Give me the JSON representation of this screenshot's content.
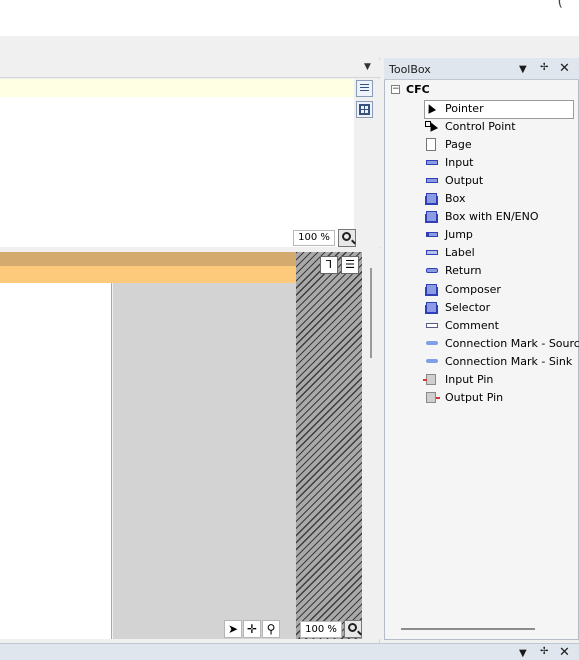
{
  "top_right_glyph": "(",
  "declaration_pane": {
    "dropdown_icon": "chevron-down-icon",
    "zoom": "100 %"
  },
  "cfc_editor": {
    "zoom": "100 %",
    "tools": [
      "pointer-tool",
      "move-tool",
      "zoom-tool"
    ]
  },
  "toolbox": {
    "title": "ToolBox",
    "root": "CFC",
    "toggle": "−",
    "items": [
      {
        "label": "Pointer",
        "icon": "pointer-icon"
      },
      {
        "label": "Control Point",
        "icon": "control-point-icon"
      },
      {
        "label": "Page",
        "icon": "page-icon"
      },
      {
        "label": "Input",
        "icon": "input-icon"
      },
      {
        "label": "Output",
        "icon": "output-icon"
      },
      {
        "label": "Box",
        "icon": "box-icon"
      },
      {
        "label": "Box with EN/ENO",
        "icon": "box-en-eno-icon"
      },
      {
        "label": "Jump",
        "icon": "jump-icon"
      },
      {
        "label": "Label",
        "icon": "label-icon"
      },
      {
        "label": "Return",
        "icon": "return-icon"
      },
      {
        "label": "Composer",
        "icon": "composer-icon"
      },
      {
        "label": "Selector",
        "icon": "selector-icon"
      },
      {
        "label": "Comment",
        "icon": "comment-icon"
      },
      {
        "label": "Connection Mark - Source",
        "icon": "connection-mark-source-icon"
      },
      {
        "label": "Connection Mark - Sink",
        "icon": "connection-mark-sink-icon"
      },
      {
        "label": "Input Pin",
        "icon": "input-pin-icon"
      },
      {
        "label": "Output Pin",
        "icon": "output-pin-icon"
      }
    ]
  },
  "colors": {
    "cfc_header_tan": "#d4aa6e",
    "cfc_header_orange": "#fdc97a",
    "declaration_yellow": "#ffffe4",
    "toolbox_title_bg": "#dfe6ee"
  }
}
